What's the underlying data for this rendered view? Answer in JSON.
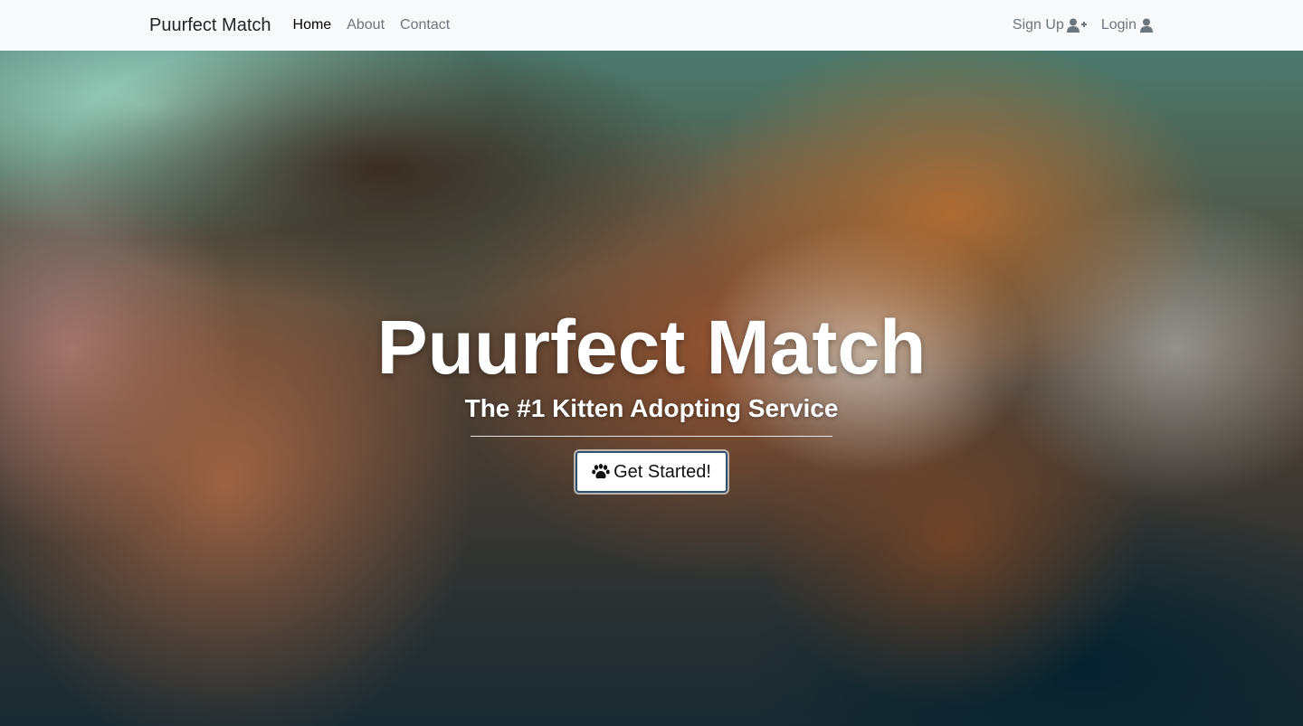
{
  "navbar": {
    "brand": "Puurfect Match",
    "links": [
      "Home",
      "About",
      "Contact"
    ],
    "signup_label": "Sign Up",
    "login_label": "Login",
    "signup_icon": "user-plus-icon",
    "login_icon": "user-icon"
  },
  "hero": {
    "title": "Puurfect Match",
    "subtitle": "The #1 Kitten Adopting Service",
    "cta_label": "Get Started!",
    "cta_icon": "paw-icon"
  }
}
